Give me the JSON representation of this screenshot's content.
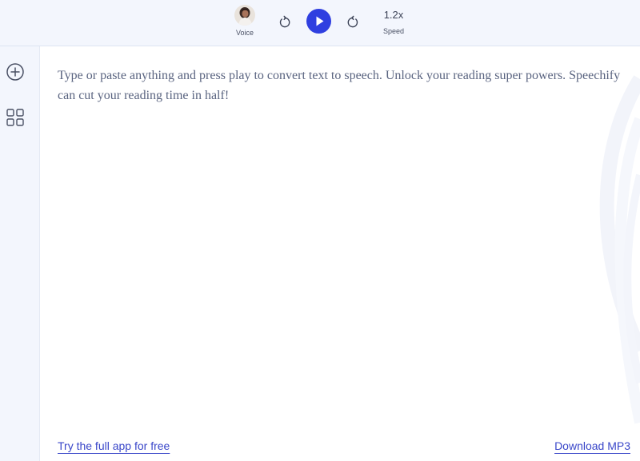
{
  "toolbar": {
    "voice_label": "Voice",
    "speed_value": "1.2x",
    "speed_label": "Speed"
  },
  "editor": {
    "placeholder_text": "Type or paste anything and press play to convert text to speech. Unlock your reading super powers. Speechify can cut your reading time in half!"
  },
  "footer": {
    "try_app_link": "Try the full app for free",
    "download_link": "Download MP3"
  },
  "colors": {
    "accent": "#2f3fe0",
    "toolbar_bg": "#f3f6fd",
    "text": "#5a6480",
    "link": "#3a47c9"
  },
  "icons": [
    "avatar",
    "rewind-icon",
    "play-icon",
    "forward-icon",
    "add-circle-icon",
    "grid-icon"
  ]
}
